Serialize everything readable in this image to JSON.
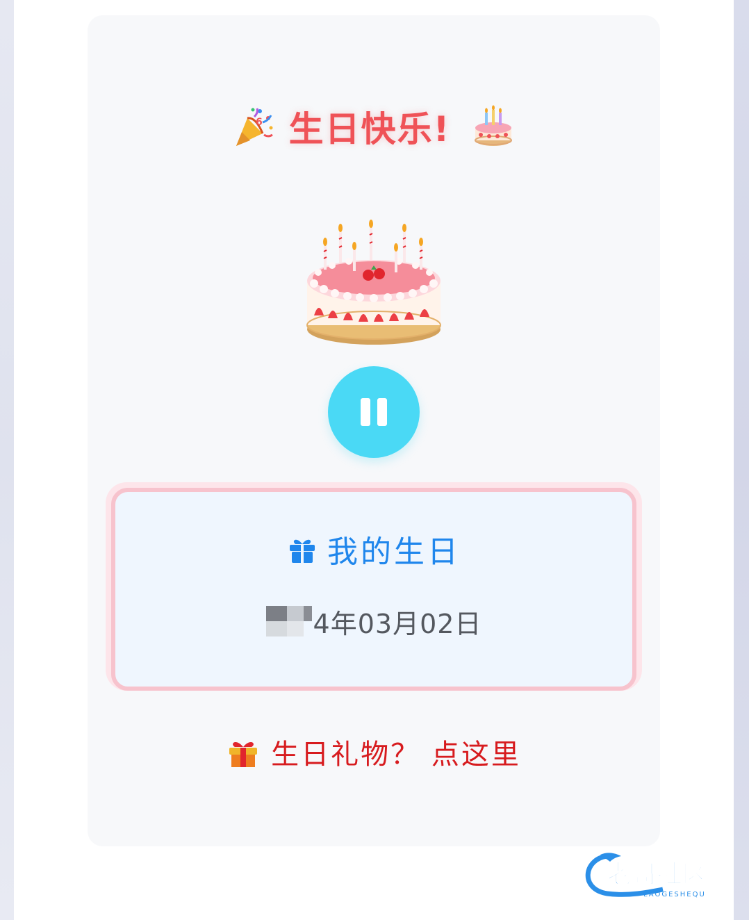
{
  "header": {
    "title": "生日快乐!",
    "left_icon": "party-popper-icon",
    "right_icon": "birthday-cake-icon"
  },
  "hero": {
    "icon": "birthday-cake-candles-icon"
  },
  "player": {
    "state": "playing",
    "button_icon": "pause-icon"
  },
  "birthday_card": {
    "icon": "gift-icon",
    "title": "我的生日",
    "date": "4年03月02日",
    "date_redacted": true
  },
  "gift_link": {
    "icon": "wrapped-gift-icon",
    "text": "生日礼物？ 点这里"
  },
  "watermark": {
    "brand": "老哥社区",
    "subtitle": "LAOGESHEQU"
  },
  "colors": {
    "title_red": "#ef5257",
    "button_cyan": "#4ad9f5",
    "info_blue": "#1f86ec",
    "link_red": "#d71b1e",
    "card_border_pink": "#f7c3cd"
  }
}
